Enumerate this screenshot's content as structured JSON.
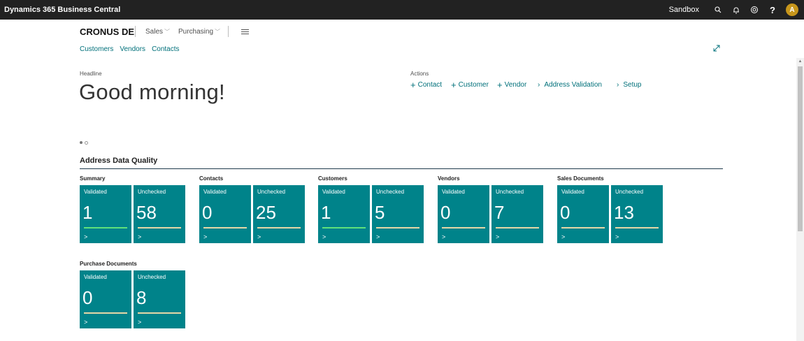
{
  "app": {
    "title": "Dynamics 365 Business Central",
    "environment": "Sandbox",
    "avatar_initial": "A"
  },
  "topbar_icons": [
    "search-icon",
    "bell-icon",
    "gear-icon",
    "help-icon"
  ],
  "nav": {
    "company": "CRONUS DE",
    "menus": [
      "Sales",
      "Purchasing"
    ],
    "links": [
      "Customers",
      "Vendors",
      "Contacts"
    ]
  },
  "headline": {
    "label": "Headline",
    "greeting": "Good morning!"
  },
  "actions": {
    "label": "Actions",
    "items": [
      {
        "prefix": "+",
        "label": "Contact"
      },
      {
        "prefix": "+",
        "label": "Customer"
      },
      {
        "prefix": "+",
        "label": "Vendor"
      },
      {
        "prefix": "›",
        "label": "Address Validation"
      },
      {
        "prefix": "›",
        "label": "Setup"
      }
    ]
  },
  "section": {
    "title": "Address Data Quality",
    "groups": [
      {
        "title": "Summary",
        "tiles": [
          {
            "label": "Validated",
            "value": "1",
            "bar": "#5fe27a"
          },
          {
            "label": "Unchecked",
            "value": "58",
            "bar": "#e6d7a6"
          }
        ]
      },
      {
        "title": "Contacts",
        "tiles": [
          {
            "label": "Validated",
            "value": "0",
            "bar": "#e6d7a6"
          },
          {
            "label": "Unchecked",
            "value": "25",
            "bar": "#e6d7a6"
          }
        ]
      },
      {
        "title": "Customers",
        "tiles": [
          {
            "label": "Validated",
            "value": "1",
            "bar": "#5fe27a"
          },
          {
            "label": "Unchecked",
            "value": "5",
            "bar": "#e6d7a6"
          }
        ]
      },
      {
        "title": "Vendors",
        "tiles": [
          {
            "label": "Validated",
            "value": "0",
            "bar": "#e6d7a6"
          },
          {
            "label": "Unchecked",
            "value": "7",
            "bar": "#e6d7a6"
          }
        ]
      },
      {
        "title": "Sales Documents",
        "tiles": [
          {
            "label": "Validated",
            "value": "0",
            "bar": "#e6d7a6"
          },
          {
            "label": "Unchecked",
            "value": "13",
            "bar": "#e6d7a6"
          }
        ]
      },
      {
        "title": "Purchase Documents",
        "tiles": [
          {
            "label": "Validated",
            "value": "0",
            "bar": "#e6d7a6"
          },
          {
            "label": "Unchecked",
            "value": "8",
            "bar": "#e6d7a6"
          }
        ]
      }
    ]
  },
  "colors": {
    "topbar": "#222222",
    "accent_link": "#00707a",
    "tile": "#00838a",
    "avatar": "#c7961b"
  }
}
